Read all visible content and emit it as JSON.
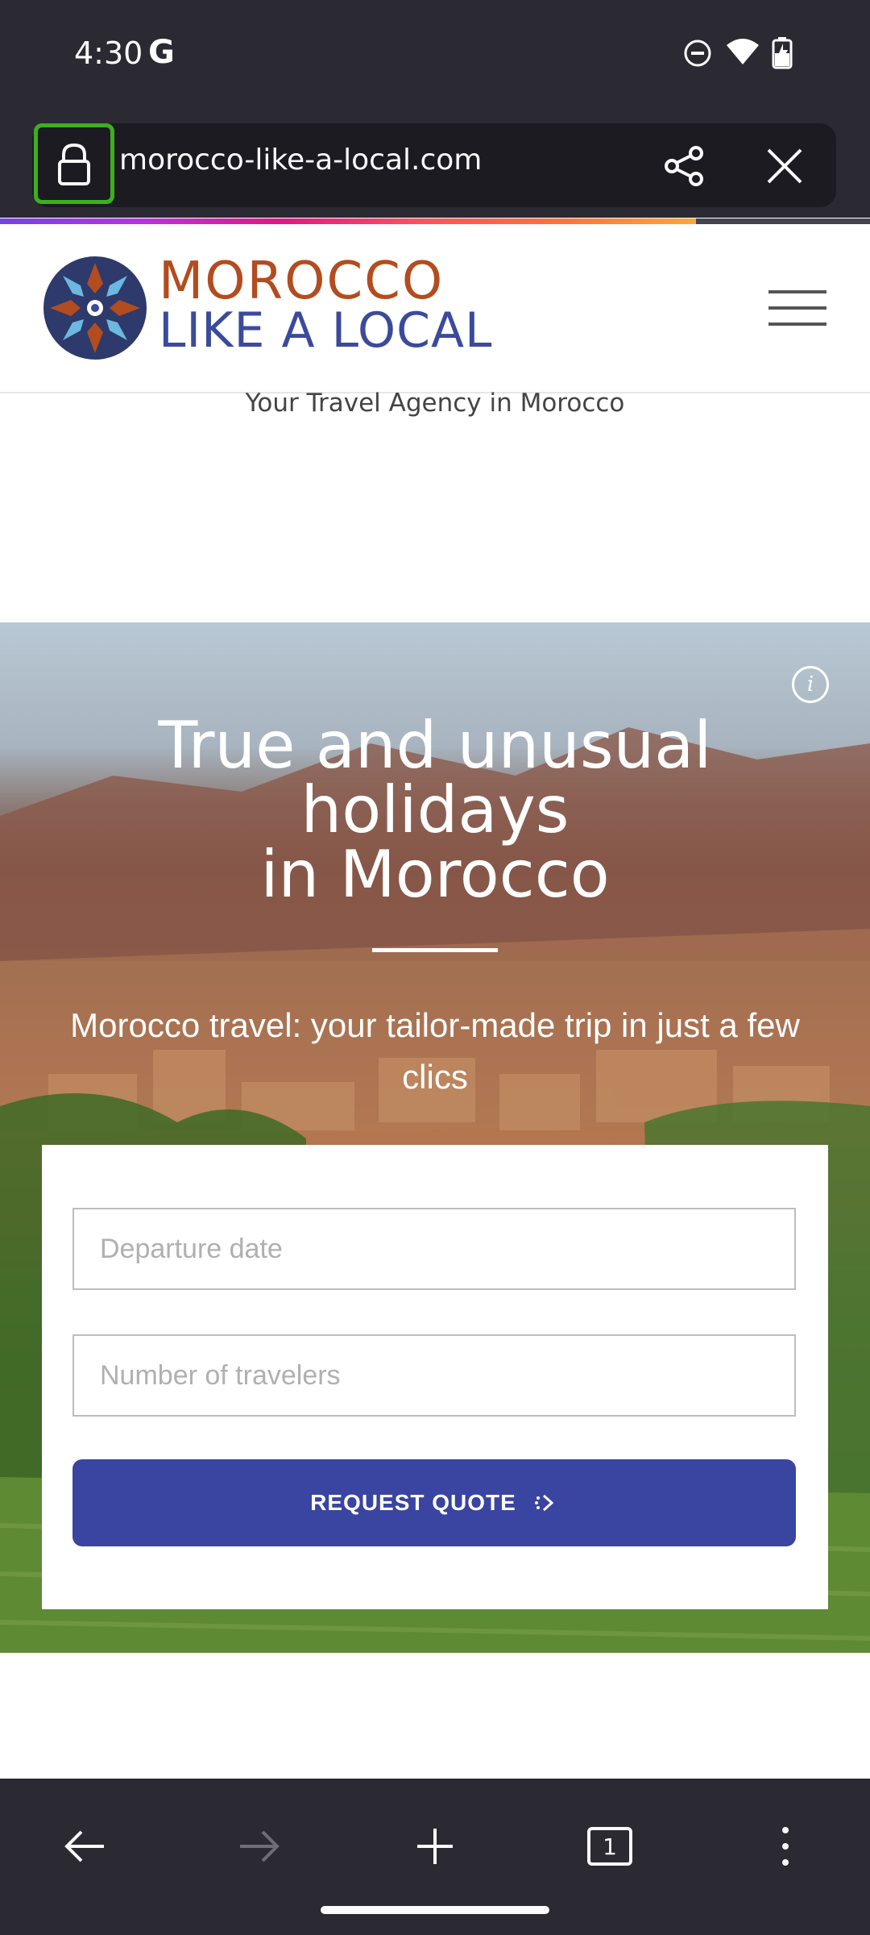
{
  "status_bar": {
    "time": "4:30",
    "google_glyph": "G",
    "icons": [
      "do-not-disturb-icon",
      "wifi-icon",
      "battery-icon"
    ]
  },
  "browser": {
    "url": "morocco-like-a-local.com",
    "load_progress_percent": 80,
    "toolbar_icons": [
      "back-arrow-icon",
      "forward-arrow-icon",
      "new-tab-plus-icon",
      "tabs-counter-icon",
      "overflow-menu-icon"
    ],
    "tab_count": "1"
  },
  "site": {
    "brand_line1": "MOROCCO",
    "brand_line2": "LIKE A LOCAL",
    "tagline": "Your Travel Agency in Morocco"
  },
  "hero": {
    "title_line1": "True and unusual",
    "title_line2": "holidays",
    "title_line3": "in Morocco",
    "subtitle": "Morocco travel: your tailor-made trip in just a few clics",
    "info_glyph": "i"
  },
  "form": {
    "departure_placeholder": "Departure date",
    "travelers_placeholder": "Number of travelers",
    "submit_label": "REQUEST QUOTE"
  },
  "colors": {
    "brand_orange": "#b34c1f",
    "brand_blue": "#3b4a9a",
    "button": "#3a44a1",
    "browser_chrome": "#2b2a33",
    "lock_highlight": "#3cb01c"
  }
}
